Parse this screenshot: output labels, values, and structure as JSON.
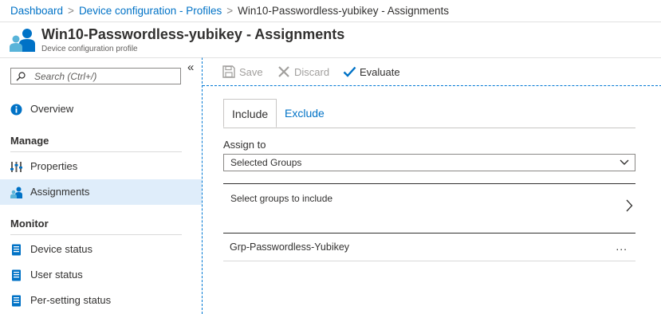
{
  "breadcrumb": {
    "items": [
      "Dashboard",
      "Device configuration - Profiles"
    ],
    "current": "Win10-Passwordless-yubikey - Assignments",
    "separator": ">"
  },
  "header": {
    "title": "Win10-Passwordless-yubikey - Assignments",
    "subtitle": "Device configuration profile",
    "icon": "assignments-people-icon"
  },
  "sidebar": {
    "collapse_glyph": "«",
    "search_placeholder": "Search (Ctrl+/)",
    "overview": {
      "label": "Overview",
      "icon": "info-icon"
    },
    "sections": [
      {
        "title": "Manage",
        "items": [
          {
            "label": "Properties",
            "icon": "properties-icon"
          },
          {
            "label": "Assignments",
            "icon": "assignments-icon",
            "selected": true
          }
        ]
      },
      {
        "title": "Monitor",
        "items": [
          {
            "label": "Device status",
            "icon": "report-icon"
          },
          {
            "label": "User status",
            "icon": "report-icon"
          },
          {
            "label": "Per-setting status",
            "icon": "report-icon"
          }
        ]
      }
    ]
  },
  "toolbar": {
    "save_label": "Save",
    "discard_label": "Discard",
    "evaluate_label": "Evaluate"
  },
  "tabs": {
    "include_label": "Include",
    "exclude_label": "Exclude",
    "active": "Include"
  },
  "assign": {
    "label": "Assign to",
    "selected_value": "Selected Groups"
  },
  "groups": {
    "picker_label": "Select groups to include",
    "rows": [
      {
        "name": "Grp-Passwordless-Yubikey",
        "more": "..."
      }
    ]
  },
  "colors": {
    "accent": "#0078d4",
    "link": "#0072c6",
    "selected_bg": "#dfedfa"
  }
}
